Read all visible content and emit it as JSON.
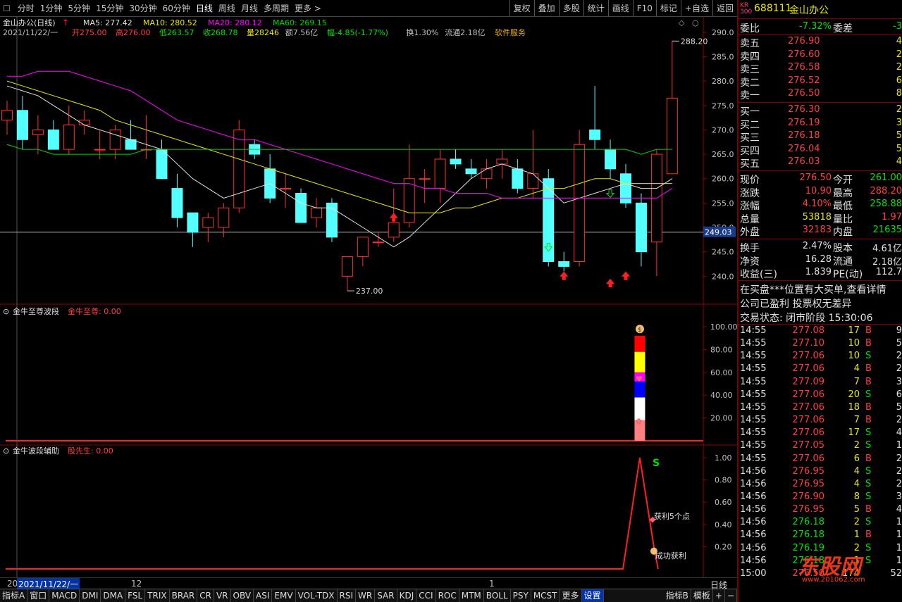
{
  "toolbar": {
    "periods": [
      "分时",
      "1分钟",
      "5分钟",
      "15分钟",
      "30分钟",
      "60分钟",
      "日线",
      "周线",
      "月线",
      "多周期",
      "更多 >"
    ],
    "active_period": "日线",
    "right_buttons": [
      "复权",
      "叠加",
      "多股",
      "统计",
      "画线",
      "F10",
      "标记",
      "+自选",
      "返回"
    ]
  },
  "main_chart": {
    "title": "金山办公(日线)",
    "ma_line": [
      {
        "label": "MA5: 277.42",
        "color": "#e0e0e0"
      },
      {
        "label": "MA10: 280.52",
        "color": "#e8e800"
      },
      {
        "label": "MA20: 280.12",
        "color": "#ff00ff"
      },
      {
        "label": "MA60: 269.15",
        "color": "#00d000"
      }
    ],
    "info_line": [
      {
        "t": "2021/11/22/一 ",
        "c": "#c0c0c0"
      },
      {
        "t": "开275.00 ",
        "c": "#ff4040"
      },
      {
        "t": "高276.00 ",
        "c": "#ff4040"
      },
      {
        "t": "低263.57 ",
        "c": "#00e000"
      },
      {
        "t": "收268.78 ",
        "c": "#00e000"
      },
      {
        "t": "量28246 ",
        "c": "#e8e800"
      },
      {
        "t": "额7.56亿 ",
        "c": "#c0c0c0"
      },
      {
        "t": "幅-4.85(-1.77%) ",
        "c": "#00e000"
      },
      {
        "t": "换1.30% ",
        "c": "#c0c0c0"
      },
      {
        "t": "流通2.18亿 ",
        "c": "#c0c0c0"
      },
      {
        "t": "软件服务",
        "c": "#e8b000"
      }
    ],
    "y_ticks": [
      "290.0",
      "285.0",
      "280.0",
      "275.0",
      "270.0",
      "265.0",
      "260.0",
      "255.0",
      "250.0",
      "245.0",
      "240.0"
    ],
    "current_price_tag": "249.03",
    "high_label": "288.20",
    "low_label": "237.00"
  },
  "chart_data": [
    {
      "type": "candlestick",
      "title": "金山办公(日线)",
      "ylim": [
        237,
        290
      ],
      "candles": [
        {
          "o": 272,
          "h": 276,
          "l": 269,
          "c": 274
        },
        {
          "o": 274,
          "h": 277,
          "l": 266,
          "c": 268
        },
        {
          "o": 269,
          "h": 273,
          "l": 265,
          "c": 270
        },
        {
          "o": 270,
          "h": 272,
          "l": 266,
          "c": 266
        },
        {
          "o": 266,
          "h": 275,
          "l": 265,
          "c": 271
        },
        {
          "o": 271,
          "h": 274,
          "l": 269,
          "c": 272
        },
        {
          "o": 266,
          "h": 270,
          "l": 264,
          "c": 266
        },
        {
          "o": 266,
          "h": 271,
          "l": 264,
          "c": 270
        },
        {
          "o": 268,
          "h": 272,
          "l": 266,
          "c": 266
        },
        {
          "o": 266,
          "h": 273,
          "l": 264,
          "c": 266
        },
        {
          "o": 266,
          "h": 268,
          "l": 260,
          "c": 260
        },
        {
          "o": 258,
          "h": 261,
          "l": 250,
          "c": 252
        },
        {
          "o": 253,
          "h": 253,
          "l": 246,
          "c": 249
        },
        {
          "o": 250,
          "h": 253,
          "l": 247,
          "c": 252
        },
        {
          "o": 250,
          "h": 255,
          "l": 248,
          "c": 254
        },
        {
          "o": 254,
          "h": 272,
          "l": 253,
          "c": 270
        },
        {
          "o": 267,
          "h": 268,
          "l": 264,
          "c": 265
        },
        {
          "o": 262,
          "h": 265,
          "l": 255,
          "c": 256
        },
        {
          "o": 258,
          "h": 261,
          "l": 254,
          "c": 258
        },
        {
          "o": 257,
          "h": 258,
          "l": 251,
          "c": 251
        },
        {
          "o": 252,
          "h": 256,
          "l": 250,
          "c": 254
        },
        {
          "o": 255,
          "h": 256,
          "l": 247,
          "c": 248
        },
        {
          "o": 240,
          "h": 244,
          "l": 237,
          "c": 244
        },
        {
          "o": 244,
          "h": 248,
          "l": 242,
          "c": 248
        },
        {
          "o": 247,
          "h": 249,
          "l": 246,
          "c": 247
        },
        {
          "o": 248,
          "h": 258,
          "l": 247,
          "c": 251
        },
        {
          "o": 251,
          "h": 267,
          "l": 250,
          "c": 260
        },
        {
          "o": 260,
          "h": 262,
          "l": 255,
          "c": 260
        },
        {
          "o": 258,
          "h": 266,
          "l": 255,
          "c": 264
        },
        {
          "o": 264,
          "h": 266,
          "l": 262,
          "c": 263
        },
        {
          "o": 262,
          "h": 264,
          "l": 260,
          "c": 261
        },
        {
          "o": 260,
          "h": 264,
          "l": 258,
          "c": 262
        },
        {
          "o": 263,
          "h": 266,
          "l": 260,
          "c": 264
        },
        {
          "o": 262,
          "h": 264,
          "l": 257,
          "c": 258
        },
        {
          "o": 258,
          "h": 270,
          "l": 256,
          "c": 261
        },
        {
          "o": 260,
          "h": 262,
          "l": 242,
          "c": 243
        },
        {
          "o": 243,
          "h": 245,
          "l": 241,
          "c": 242
        },
        {
          "o": 243,
          "h": 270,
          "l": 242,
          "c": 267
        },
        {
          "o": 270,
          "h": 279,
          "l": 266,
          "c": 268
        },
        {
          "o": 266,
          "h": 268,
          "l": 260,
          "c": 262
        },
        {
          "o": 261,
          "h": 263,
          "l": 254,
          "c": 255
        },
        {
          "o": 255,
          "h": 257,
          "l": 242,
          "c": 245
        },
        {
          "o": 247,
          "h": 266,
          "l": 240,
          "c": 265
        },
        {
          "o": 261,
          "h": 288.2,
          "l": 261,
          "c": 276.5
        }
      ],
      "ma_series": [
        {
          "name": "MA5",
          "color": "#e0e0e0",
          "values": [
            279,
            278,
            277,
            275,
            273,
            271,
            270,
            269,
            268,
            267,
            266,
            263,
            260,
            258,
            256,
            257,
            258,
            259,
            257,
            255,
            254,
            254,
            252,
            250,
            248,
            246,
            248,
            251,
            254,
            257,
            260,
            262,
            263,
            262,
            261,
            258,
            255,
            256,
            257,
            258,
            259,
            258,
            258,
            260
          ]
        },
        {
          "name": "MA10",
          "color": "#e8e800",
          "values": [
            280,
            279,
            278,
            277,
            276,
            275,
            274,
            272,
            271,
            270,
            269,
            268,
            267,
            266,
            265,
            264,
            263,
            262,
            261,
            260,
            259,
            258,
            257,
            256,
            255,
            254,
            253,
            253,
            253,
            254,
            254,
            255,
            256,
            256,
            257,
            258,
            258,
            259,
            260,
            260,
            259,
            259,
            259,
            259
          ]
        },
        {
          "name": "MA20",
          "color": "#ff00ff",
          "values": [
            281,
            281,
            282,
            282,
            282,
            281,
            280,
            279,
            278,
            276,
            274,
            272,
            271,
            270,
            269,
            268,
            268,
            267,
            266,
            265,
            264,
            263,
            262,
            261,
            260,
            259,
            259,
            258,
            258,
            257,
            257,
            257,
            256,
            256,
            256,
            256,
            256,
            256,
            256,
            256,
            256,
            256,
            256,
            258
          ]
        },
        {
          "name": "MA60",
          "color": "#00d000",
          "values": [
            267,
            266,
            266,
            265,
            265,
            265,
            265,
            265,
            265,
            266,
            266,
            266,
            266,
            266,
            266,
            266,
            266,
            266,
            266,
            266,
            266,
            266,
            266,
            266,
            266,
            266,
            266,
            266,
            266,
            266,
            266,
            266,
            266,
            266,
            266,
            266,
            266,
            266,
            266,
            266,
            266,
            265,
            266,
            266
          ]
        }
      ]
    },
    {
      "type": "bar",
      "title": "金牛至尊波段",
      "ylim": [
        0,
        100
      ],
      "y_ticks": [
        "100.00",
        "80.00",
        "60.00",
        "40.00",
        "20.00"
      ],
      "stacked_segments": [
        {
          "from": 0,
          "to": 18,
          "color": "#ff8080"
        },
        {
          "from": 18,
          "to": 38,
          "color": "#ffffff"
        },
        {
          "from": 38,
          "to": 52,
          "color": "#0000ff"
        },
        {
          "from": 52,
          "to": 60,
          "color": "#ff00ff"
        },
        {
          "from": 60,
          "to": 78,
          "color": "#ffff00"
        },
        {
          "from": 78,
          "to": 92,
          "color": "#ff0000"
        }
      ]
    },
    {
      "type": "line",
      "title": "金牛波段辅助",
      "ylim": [
        0,
        1.1
      ],
      "y_ticks": [
        "1.00",
        "0.80",
        "0.60",
        "0.40",
        "0.20"
      ],
      "x": [
        0,
        40,
        41,
        42,
        43
      ],
      "values": [
        0,
        0,
        1,
        0.2,
        0
      ],
      "annotations": [
        "S",
        "获利5个点",
        "成功获利"
      ]
    }
  ],
  "sub1": {
    "title": "金牛至尊波段",
    "value_label": "金牛至尊: 0.00"
  },
  "sub2": {
    "title": "金牛波段辅助",
    "value_label": "股先生: 0.00",
    "signal": "S",
    "note1": "获利5个点",
    "note2": "成功获利"
  },
  "date_bar": {
    "left_label": "20",
    "current_date": "2021/11/22/一",
    "mark1": "12",
    "mark2": "1",
    "right_label": "日线"
  },
  "bottom_tabs": [
    "指标A",
    "窗口",
    "MACD",
    "DMI",
    "DMA",
    "FSL",
    "TRIX",
    "BRAR",
    "CR",
    "VR",
    "OBV",
    "ASI",
    "EMV",
    "VOL-TDX",
    "RSI",
    "WR",
    "SAR",
    "KDJ",
    "CCI",
    "ROC",
    "MTM",
    "BOLL",
    "PSY",
    "MCST",
    "更多",
    "设置"
  ],
  "bottom_right": [
    "指标B",
    "模板",
    "+",
    "−"
  ],
  "quote": {
    "badge_top": "KR",
    "badge_bottom": "300",
    "code": "688111",
    "name": "金山办公",
    "weibi_label": "委比",
    "weibi_value": "-7.32%",
    "weicha_label": "委差",
    "weicha_value": "-3",
    "sells": [
      {
        "l": "卖五",
        "p": "276.90",
        "v": "4"
      },
      {
        "l": "卖四",
        "p": "276.60",
        "v": "2"
      },
      {
        "l": "卖三",
        "p": "276.58",
        "v": "2"
      },
      {
        "l": "卖二",
        "p": "276.52",
        "v": "6"
      },
      {
        "l": "卖一",
        "p": "276.50",
        "v": "8"
      }
    ],
    "buys": [
      {
        "l": "买一",
        "p": "276.30",
        "v": "2"
      },
      {
        "l": "买二",
        "p": "276.19",
        "v": "3"
      },
      {
        "l": "买三",
        "p": "276.18",
        "v": "5"
      },
      {
        "l": "买四",
        "p": "276.04",
        "v": "5"
      },
      {
        "l": "买五",
        "p": "276.03",
        "v": "4"
      }
    ],
    "stats": [
      {
        "l1": "现价",
        "v1": "276.50",
        "c1": "#ff4040",
        "l2": "今开",
        "v2": "261.00",
        "c2": "#00e000"
      },
      {
        "l1": "涨跌",
        "v1": "10.90",
        "c1": "#ff4040",
        "l2": "最高",
        "v2": "288.20",
        "c2": "#ff4040"
      },
      {
        "l1": "涨幅",
        "v1": "4.10%",
        "c1": "#ff4040",
        "l2": "最低",
        "v2": "258.88",
        "c2": "#00e000"
      },
      {
        "l1": "总量",
        "v1": "53818",
        "c1": "#e8e800",
        "l2": "量比",
        "v2": "1.97",
        "c2": "#ff4040"
      },
      {
        "l1": "外盘",
        "v1": "32183",
        "c1": "#ff4040",
        "l2": "内盘",
        "v2": "21635",
        "c2": "#00e000"
      }
    ],
    "stats2": [
      {
        "l1": "换手",
        "v1": "2.47%",
        "l2": "股本",
        "v2": "4.61亿"
      },
      {
        "l1": "净资",
        "v1": "16.28",
        "l2": "流通",
        "v2": "2.18亿"
      },
      {
        "l1": "收益(三)",
        "v1": "1.839",
        "l2": "PE(动)",
        "v2": "112.7"
      }
    ],
    "notice1": "在买盘***位置有大买单,查看详情",
    "notice2": "公司已盈利 投票权无差异",
    "status": "交易状态: 闭市阶段 15:30:06",
    "ticks": [
      {
        "t": "14:55",
        "p": "277.08",
        "v": "17",
        "s": "B",
        "n": "9"
      },
      {
        "t": "14:55",
        "p": "277.10",
        "v": "10",
        "s": "B",
        "n": "5"
      },
      {
        "t": "14:55",
        "p": "277.06",
        "v": "10",
        "s": "S",
        "n": "2"
      },
      {
        "t": "14:55",
        "p": "277.06",
        "v": "4",
        "s": "B",
        "n": "2"
      },
      {
        "t": "14:55",
        "p": "277.09",
        "v": "7",
        "s": "B",
        "n": "3"
      },
      {
        "t": "14:55",
        "p": "277.06",
        "v": "20",
        "s": "S",
        "n": "6"
      },
      {
        "t": "14:55",
        "p": "277.06",
        "v": "18",
        "s": "B",
        "n": "5"
      },
      {
        "t": "14:55",
        "p": "277.06",
        "v": "7",
        "s": "B",
        "n": "2"
      },
      {
        "t": "14:55",
        "p": "277.06",
        "v": "17",
        "s": "S",
        "n": "4"
      },
      {
        "t": "14:55",
        "p": "277.05",
        "v": "2",
        "s": "S",
        "n": "1"
      },
      {
        "t": "14:55",
        "p": "277.06",
        "v": "6",
        "s": "B",
        "n": "2"
      },
      {
        "t": "14:56",
        "p": "276.95",
        "v": "4",
        "s": "S",
        "n": "2"
      },
      {
        "t": "14:56",
        "p": "276.95",
        "v": "4",
        "s": "S",
        "n": "2"
      },
      {
        "t": "14:56",
        "p": "276.90",
        "v": "8",
        "s": "S",
        "n": "3"
      },
      {
        "t": "14:56",
        "p": "276.95",
        "v": "5",
        "s": "B",
        "n": "4"
      },
      {
        "t": "14:56",
        "p": "276.18",
        "v": "2",
        "s": "S",
        "n": "1"
      },
      {
        "t": "14:56",
        "p": "276.18",
        "v": "1",
        "s": "B",
        "n": "1"
      },
      {
        "t": "14:56",
        "p": "276.19",
        "v": "2",
        "s": "S",
        "n": "1"
      },
      {
        "t": "14:56",
        "p": "276.18",
        "v": "1",
        "s": "S",
        "n": "1"
      },
      {
        "t": "15:00",
        "p": "276.50",
        "v": "174",
        "s": "",
        "n": "52"
      }
    ]
  },
  "watermark": "东股网",
  "watermark_sub": "www.201062.com"
}
